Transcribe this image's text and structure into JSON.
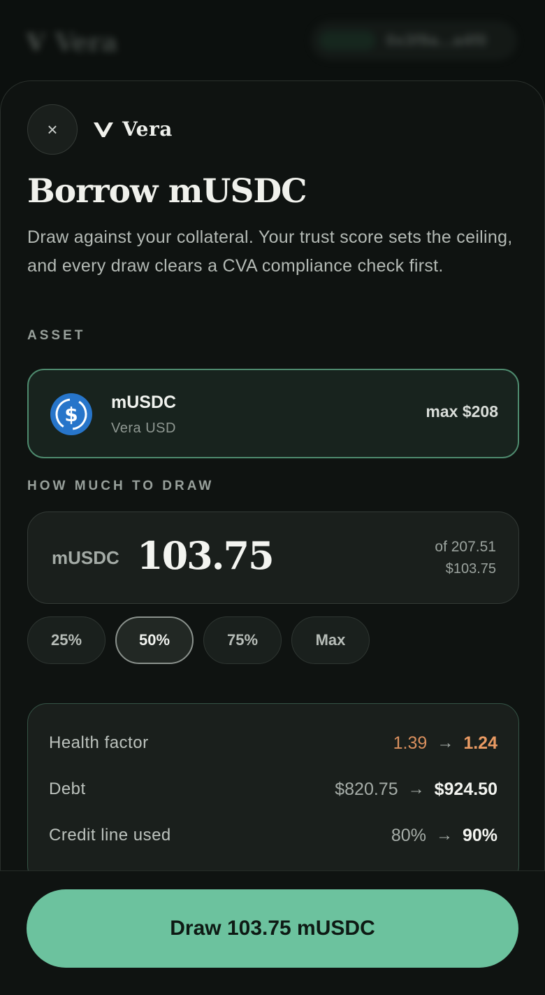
{
  "background_header": {
    "brand": "Vera",
    "wallet_address": "0x3f9a...a4f0"
  },
  "sheet": {
    "brand_name": "Vera",
    "close_icon": "×",
    "title": "Borrow mUSDC",
    "description": "Draw against your collateral. Your trust score sets the ceiling, and every draw clears a CVA compliance check first."
  },
  "asset": {
    "section_label": "ASSET",
    "icon": "usdc-icon",
    "name": "mUSDC",
    "subtitle": "Vera USD",
    "max": "max $208"
  },
  "amount": {
    "section_label": "HOW MUCH TO DRAW",
    "unit": "mUSDC",
    "value": "103.75",
    "of_total": "of 207.51",
    "usd_value": "$103.75"
  },
  "presets": [
    "25%",
    "50%",
    "75%",
    "Max"
  ],
  "selected_preset": "50%",
  "stats": {
    "health_factor": {
      "label": "Health factor",
      "from": "1.39",
      "to": "1.24"
    },
    "debt": {
      "label": "Debt",
      "from": "$820.75",
      "to": "$924.50"
    },
    "credit_line": {
      "label": "Credit line used",
      "from": "80%",
      "to": "90%"
    },
    "arrow": "→"
  },
  "cta": {
    "label": "Draw 103.75 mUSDC"
  },
  "colors": {
    "accent": "#6cc29e",
    "warning": "#e99a63",
    "usdc_blue": "#2775ca",
    "background": "#0c100e"
  }
}
